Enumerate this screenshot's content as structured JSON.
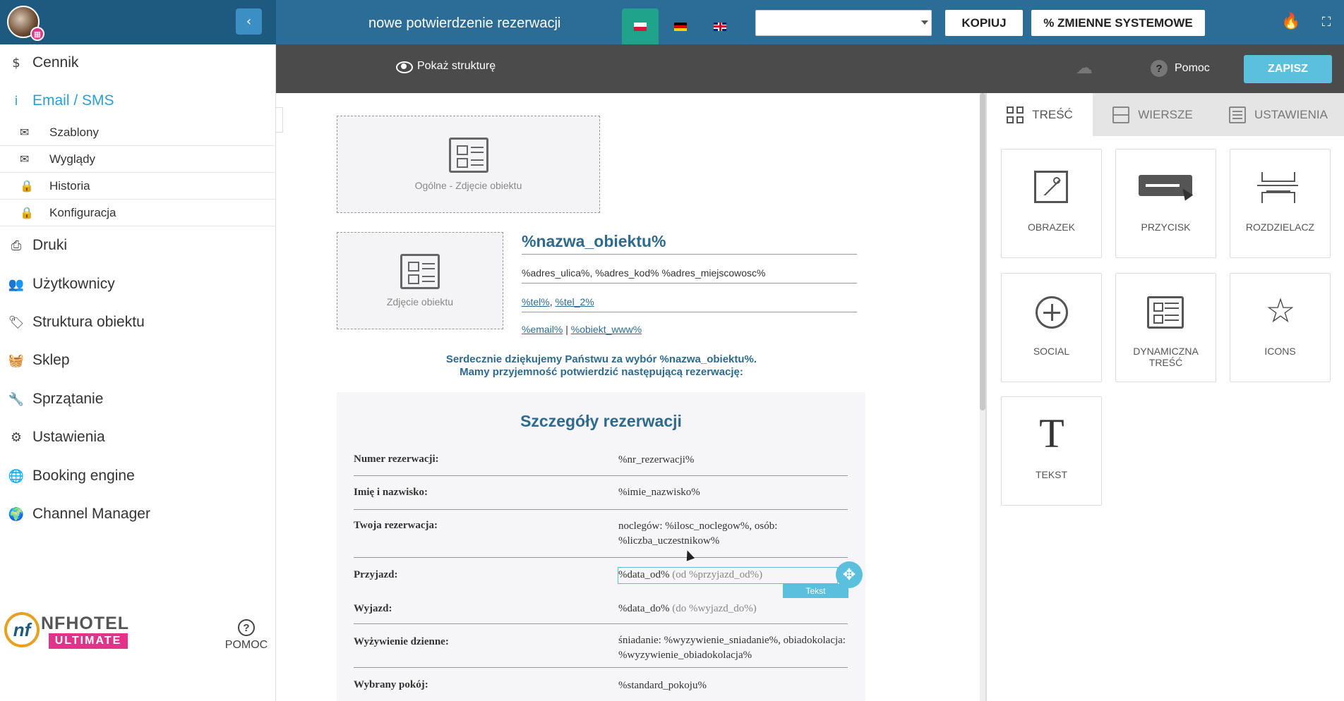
{
  "header": {
    "title": "nowe potwierdzenie rezerwacji",
    "collapse_icon": "‹",
    "languages": [
      {
        "code": "pl",
        "icon": "flag-pl-icon"
      },
      {
        "code": "de",
        "icon": "flag-de-icon"
      },
      {
        "code": "en",
        "icon": "flag-en-icon"
      }
    ],
    "active_language": "pl",
    "template_select_value": "",
    "copy_label": "KOPIUJ",
    "system_vars_label": "% ZMIENNE SYSTEMOWE"
  },
  "sidebar": {
    "items": [
      {
        "label": "Cennik",
        "icon": "$"
      },
      {
        "label": "Email / SMS",
        "icon": "i",
        "active": true
      },
      {
        "label": "Druki",
        "icon": "⎙"
      },
      {
        "label": "Użytkownicy",
        "icon": "👥"
      },
      {
        "label": "Struktura obiektu",
        "icon": "🏷"
      },
      {
        "label": "Sklep",
        "icon": "🧺"
      },
      {
        "label": "Sprzątanie",
        "icon": "🔧"
      },
      {
        "label": "Ustawienia",
        "icon": "⚙"
      },
      {
        "label": "Booking engine",
        "icon": "🌐"
      },
      {
        "label": "Channel Manager",
        "icon": "🌍"
      }
    ],
    "sub_items": [
      {
        "label": "Szablony",
        "icon": "✉"
      },
      {
        "label": "Wyglądy",
        "icon": "✉"
      },
      {
        "label": "Historia",
        "icon": "🔒"
      },
      {
        "label": "Konfiguracja",
        "icon": "🔒"
      }
    ],
    "brand": {
      "mark": "nf",
      "name": "NFHOTEL",
      "edition": "ULTIMATE"
    },
    "help_label": "POMOC",
    "help_icon": "?"
  },
  "toolbar": {
    "show_structure": "Pokaż strukturę",
    "help": "Pomoc",
    "help_icon": "?",
    "save": "ZAPISZ",
    "cloud_icon": "☁"
  },
  "email": {
    "main_photo": "Ogólne - Zdjęcie obiektu",
    "object_photo": "Zdjęcie obiektu",
    "hotel_name": "%nazwa_obiektu%",
    "address": "%adres_ulica%, %adres_kod% %adres_miejscowosc%",
    "tel": "%tel%",
    "tel_sep": ",",
    "tel2": "%tel_2%",
    "email": "%email%",
    "email_sep": "|",
    "www": "%obiekt_www%",
    "thanks_line1": "Serdecznie dziękujemy Państwu za wybór %nazwa_obiektu%.",
    "thanks_line2": "Mamy przyjemność potwierdzić następującą rezerwację:",
    "details_title": "Szczegóły rezerwacji",
    "rows": [
      {
        "label": "Numer rezerwacji:",
        "value": "%nr_rezerwacji%"
      },
      {
        "label": "Imię i nazwisko:",
        "value": "%imie_nazwisko%"
      },
      {
        "label": "Twoja rezerwacja:",
        "value": "noclegów: %ilosc_noclegow%, osób: %liczba_uczestnikow%"
      },
      {
        "label": "Przyjazd:",
        "value": "%data_od%",
        "extra": "(od %przyjazd_od%)"
      },
      {
        "label": "Wyjazd:",
        "value": "%data_do%",
        "extra": "(do %wyjazd_do%)"
      },
      {
        "label": "Wyżywienie dzienne:",
        "value": "śniadanie: %wyzywienie_sniadanie%, obiadokolacja: %wyzywienie_obiadokolacja%"
      },
      {
        "label": "Wybrany pokój:",
        "value": "%standard_pokoju%"
      }
    ],
    "selected_tag": "Tekst",
    "move_icon": "✥"
  },
  "panel": {
    "tabs": [
      "TREŚĆ",
      "WIERSZE",
      "USTAWIENIA"
    ],
    "active_tab": 0,
    "blocks": [
      {
        "label": "OBRAZEK",
        "icon": "image-icon"
      },
      {
        "label": "PRZYCISK",
        "icon": "button-icon"
      },
      {
        "label": "ROZDZIELACZ",
        "icon": "divider-icon"
      },
      {
        "label": "SOCIAL",
        "icon": "social-icon"
      },
      {
        "label": "DYNAMICZNA TREŚĆ",
        "icon": "dynamic-content-icon"
      },
      {
        "label": "ICONS",
        "icon": "star-icon"
      },
      {
        "label": "TEKST",
        "icon": "text-icon"
      }
    ],
    "star_glyph": "☆",
    "text_glyph": "T"
  }
}
